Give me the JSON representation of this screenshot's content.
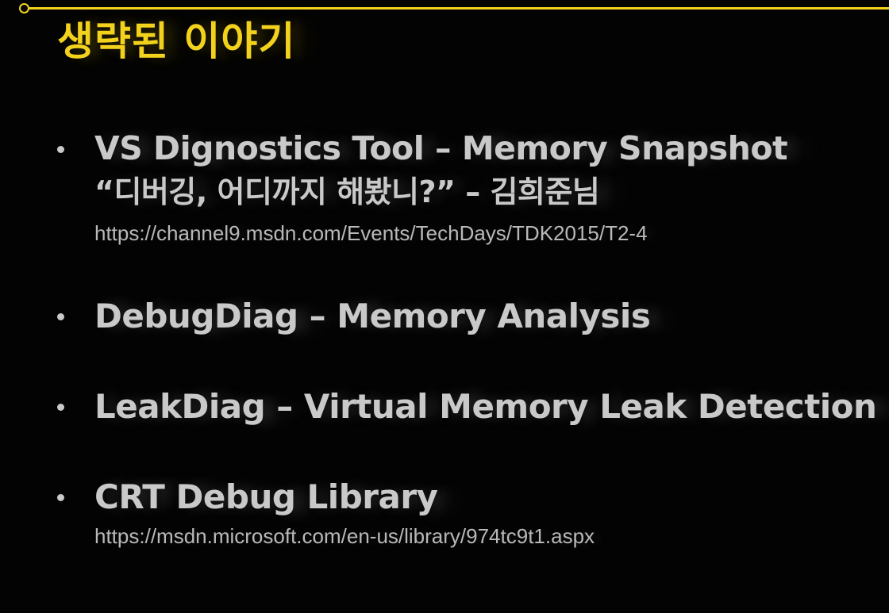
{
  "slide": {
    "title": "생략된 이야기",
    "accent_color": "#f2d21c",
    "text_color": "#c9c9c9",
    "background_color": "#030303"
  },
  "bullets": [
    {
      "text": "VS Dignostics Tool – Memory Snapshot",
      "sub": "“디버깅, 어디까지 해봤니?” – 김희준님",
      "url": "https://channel9.msdn.com/Events/TechDays/TDK2015/T2-4"
    },
    {
      "text": "DebugDiag  –  Memory Analysis"
    },
    {
      "text": "LeakDiag  –  Virtual Memory Leak Detection"
    },
    {
      "text": "CRT Debug Library",
      "url": "https://msdn.microsoft.com/en-us/library/974tc9t1.aspx"
    }
  ]
}
